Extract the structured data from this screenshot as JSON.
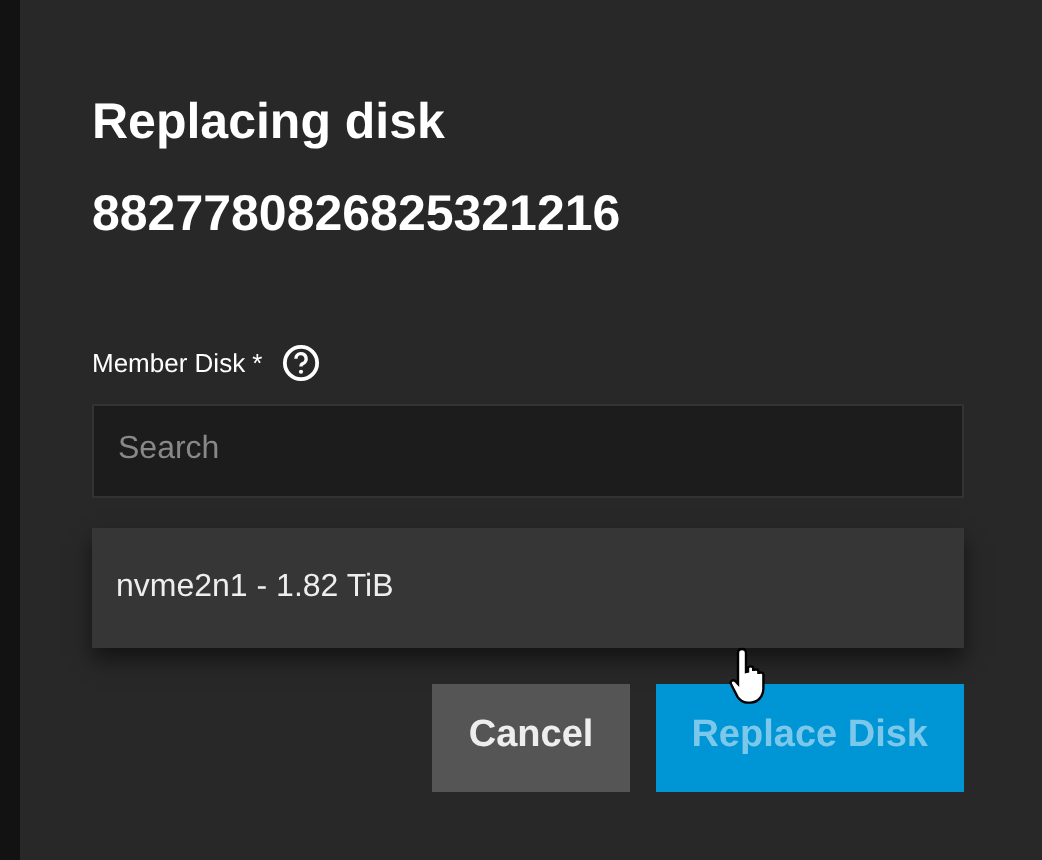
{
  "dialog": {
    "title_lines": [
      "Replacing disk",
      "8827780826825321216"
    ],
    "field": {
      "label": "Member Disk",
      "required_mark": "*",
      "placeholder": "Search"
    },
    "options": [
      {
        "label": "nvme2n1 - 1.82 TiB",
        "selected": false
      }
    ],
    "buttons": [
      {
        "label": "Cancel",
        "kind": "secondary",
        "disabled": false
      },
      {
        "label": "Replace Disk",
        "kind": "primary",
        "disabled": true
      }
    ]
  }
}
